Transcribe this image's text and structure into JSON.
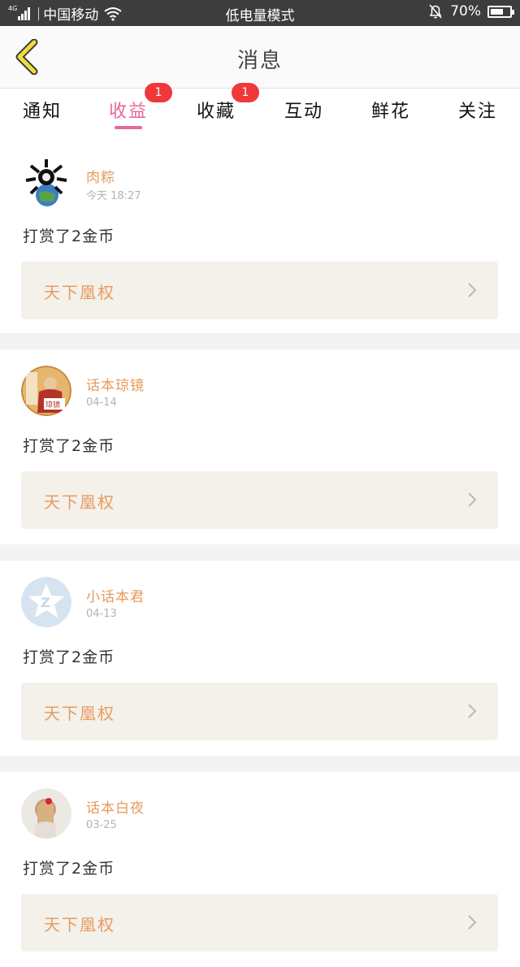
{
  "status_bar": {
    "network": "4G",
    "carrier": "中国移动",
    "center_text": "低电量模式",
    "battery": "70%",
    "battery_level": 0.7
  },
  "header": {
    "title": "消息",
    "back_icon": "chevron-left-icon"
  },
  "tabs": [
    {
      "label": "通知",
      "active": false
    },
    {
      "label": "收益",
      "active": true,
      "badge": "1"
    },
    {
      "label": "收藏",
      "active": false,
      "badge": "1"
    },
    {
      "label": "互动",
      "active": false
    },
    {
      "label": "鲜花",
      "active": false
    },
    {
      "label": "关注",
      "active": false
    }
  ],
  "colors": {
    "accent": "#e8689c",
    "name": "#e69a5a",
    "badge": "#f0383b",
    "book_bg": "#f3f1ea"
  },
  "feed": [
    {
      "name": "肉粽",
      "time": "今天 18:27",
      "message": "打赏了2金币",
      "book": "天下凰权"
    },
    {
      "name": "话本琼镜",
      "time": "04-14",
      "message": "打赏了2金币",
      "book": "天下凰权"
    },
    {
      "name": "小话本君",
      "time": "04-13",
      "message": "打赏了2金币",
      "book": "天下凰权"
    },
    {
      "name": "话本白夜",
      "time": "03-25",
      "message": "打赏了2金币",
      "book": "天下凰权"
    }
  ]
}
